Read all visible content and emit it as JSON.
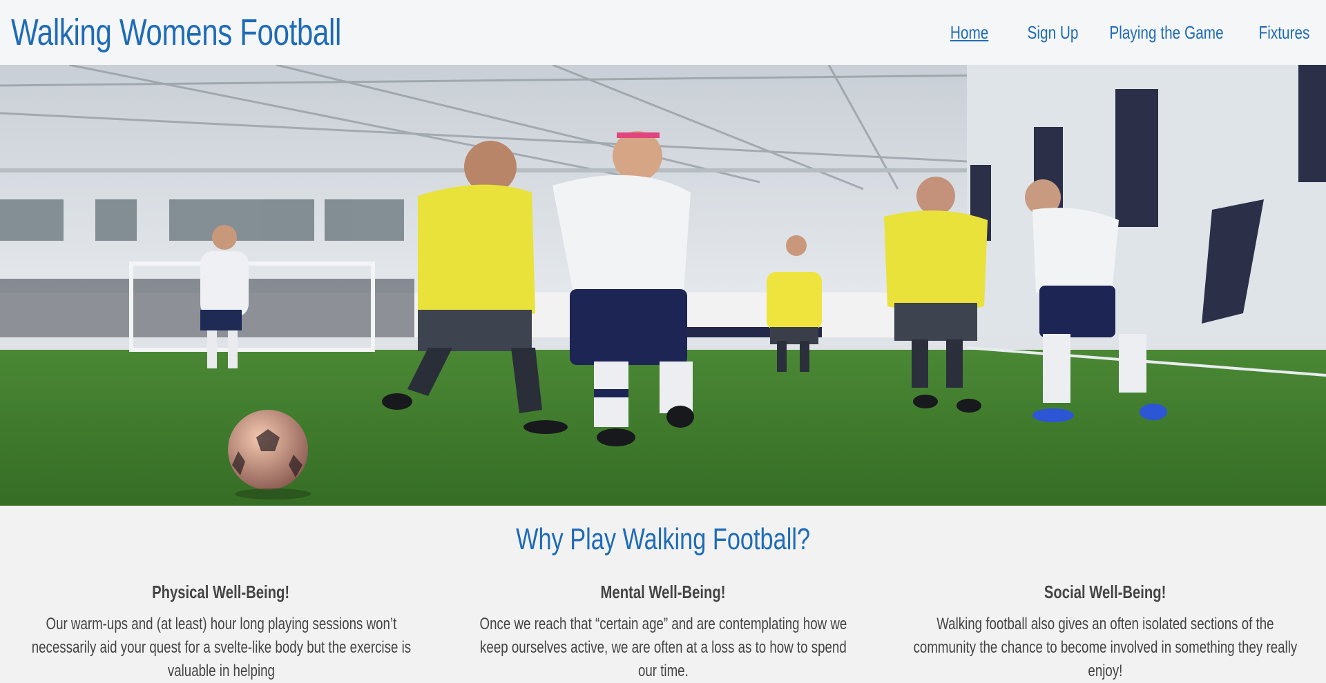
{
  "header": {
    "brand": "Walking Womens Football",
    "nav": [
      {
        "label": "Home",
        "active": true
      },
      {
        "label": "Sign Up",
        "active": false
      },
      {
        "label": "Playing the Game",
        "active": false
      },
      {
        "label": "Fixtures",
        "active": false
      }
    ]
  },
  "hero": {
    "image": "indoor-football-pitch-photo"
  },
  "main": {
    "title": "Why Play Walking Football?",
    "columns": [
      {
        "heading": "Physical Well-Being!",
        "text": "Our warm-ups and (at least) hour long playing sessions won’t necessarily aid your quest for a svelte-like body but the exercise is valuable in helping"
      },
      {
        "heading": "Mental Well-Being!",
        "text": "Once we reach that “certain age” and are contemplating how we keep ourselves active, we are often at a loss as to how to spend our time."
      },
      {
        "heading": "Social Well-Being!",
        "text": "Walking football also gives an often isolated sections of the community the chance to become involved in something they really enjoy!"
      }
    ]
  },
  "colors": {
    "brand": "#1e6bb8",
    "header_bg": "#f5f6f7",
    "page_bg": "#f2f2f2",
    "pitch": "#3f7a2c",
    "bib_yellow": "#e8e23a",
    "navy": "#1c2553"
  }
}
